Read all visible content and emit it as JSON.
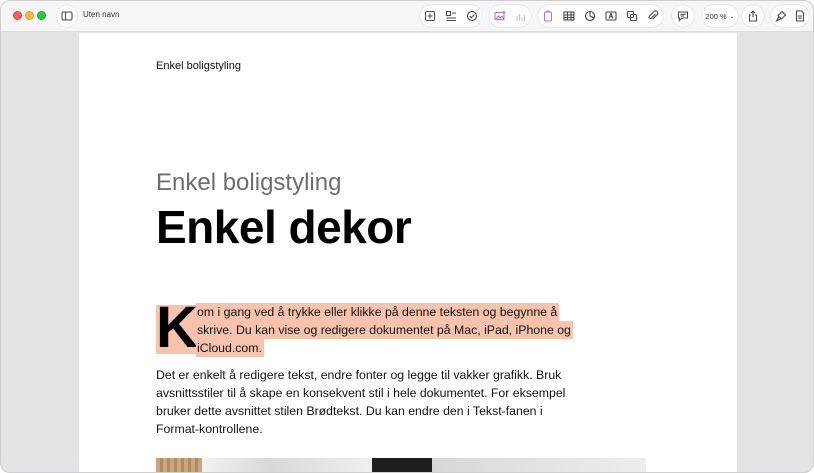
{
  "window": {
    "title": "Uten navn"
  },
  "toolbar": {
    "zoom": "200 %",
    "icons": [
      "sidebar-icon",
      "add-page-icon",
      "insert-list-icon",
      "spellcheck-icon",
      "media-icon",
      "chart-icon",
      "text-box-icon",
      "table-icon",
      "chart-pie-icon",
      "text-icon",
      "shape-icon",
      "attachment-icon",
      "comment-icon",
      "share-icon",
      "format-brush-icon",
      "document-icon"
    ]
  },
  "document": {
    "header": "Enkel boligstyling",
    "subtitle": "Enkel boligstyling",
    "title": "Enkel dekor",
    "dropcap": "K",
    "highlighted_lines": [
      "om i gang ved å trykke eller klikke på denne teksten og begynne å",
      "skrive. Du kan vise og redigere dokumentet på Mac, iPad, iPhone og",
      "iCloud.com."
    ],
    "body_lines": [
      "Det er enkelt å redigere tekst, endre fonter og legge til vakker grafikk. Bruk",
      "avsnittsstiler til å skape en konsekvent stil i hele dokumentet. For eksempel",
      "bruker dette avsnittet stilen Brødtekst. Du kan endre den i Tekst-fanen i",
      "Format-kontrollene."
    ]
  },
  "colors": {
    "highlight": "#f8c3ad",
    "accent_purple": "#b06fd8"
  }
}
